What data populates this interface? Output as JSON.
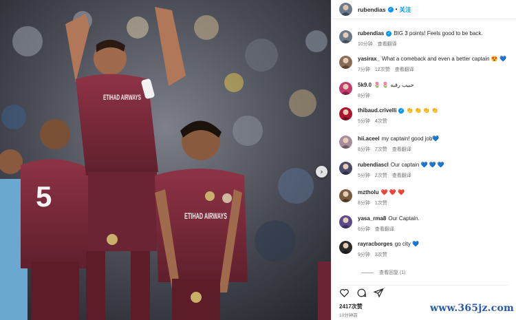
{
  "post": {
    "author": "rubendias",
    "follow_label": "关注",
    "separator": "•"
  },
  "photo": {
    "jersey_sponsor_1": "ETIHAD AIRWAYS",
    "jersey_sponsor_2": "ETIHAD AIRWAYS",
    "number": "5"
  },
  "comments": [
    {
      "user": "rubendias",
      "text": "BIG 3 points! Feels good to be back.",
      "time": "10分钟",
      "likes": "",
      "action": "查看翻译",
      "verified": true,
      "avatar_color": "#6b7a8a"
    },
    {
      "user": "yasirax_",
      "text": "What a comeback and even a better captain 😍 💙",
      "time": "7分钟",
      "likes": "12次赞",
      "action": "查看翻译",
      "verified": false,
      "avatar_color": "#8a6b55"
    },
    {
      "user": "5k9.0",
      "text": "🌷 🌷 حبيب رقبه",
      "time": "8分钟",
      "likes": "",
      "action": "",
      "verified": false,
      "avatar_color": "#c33a6e"
    },
    {
      "user": "thibaud.crivelli",
      "text": "👏 👏 👏 👏",
      "time": "5分钟",
      "likes": "4次赞",
      "action": "",
      "verified": true,
      "avatar_color": "#b0142d"
    },
    {
      "user": "hii.aceel",
      "text": "my captain! good job💙",
      "time": "8分钟",
      "likes": "7次赞",
      "action": "查看翻译",
      "verified": false,
      "avatar_color": "#a88c9c"
    },
    {
      "user": "rubendiascl",
      "text": "Our captain 💙 💙 💙",
      "time": "5分钟",
      "likes": "2次赞",
      "action": "查看翻译",
      "verified": false,
      "avatar_color": "#4a4a6a"
    },
    {
      "user": "mztholu",
      "text": "❤️ ❤️ ❤️",
      "time": "8分钟",
      "likes": "1次赞",
      "action": "",
      "verified": false,
      "avatar_color": "#7a5d3e"
    },
    {
      "user": "yasa_rma8",
      "text": "Our Captain.",
      "time": "6分钟",
      "likes": "",
      "action": "查看翻译",
      "verified": false,
      "avatar_color": "#5d4a8a"
    },
    {
      "user": "rayracborges",
      "text": "go city 💙",
      "time": "9分钟",
      "likes": "3次赞",
      "action": "",
      "verified": false,
      "avatar_color": "#2b2b2b"
    }
  ],
  "view_replies": "查看回复 (1)",
  "likes_total": "2417次赞",
  "posted_ago": "10分钟前",
  "watermark": "www.365jz.com",
  "colors": {
    "accent": "#0095f6",
    "jersey": "#7a2a3a",
    "watermark": "#2a5aa8"
  },
  "icons": {
    "like": "heart-icon",
    "comment": "comment-icon",
    "share": "send-icon",
    "next": "chevron-right-icon"
  }
}
